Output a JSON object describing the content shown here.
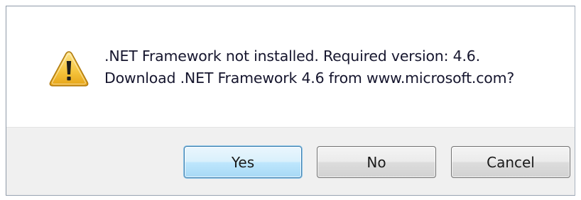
{
  "dialog": {
    "icon": "warning-icon",
    "message_line1": ".NET Framework not installed. Required version: 4.6.",
    "message_line2": "Download .NET Framework 4.6 from www.microsoft.com?",
    "buttons": {
      "yes": "Yes",
      "no": "No",
      "cancel": "Cancel"
    },
    "default_button": "yes"
  },
  "colors": {
    "warning_fill": "#f5c33b",
    "warning_border": "#b07b12",
    "default_button_border": "#3c7fb1",
    "footer_background": "#f0f0f0"
  }
}
